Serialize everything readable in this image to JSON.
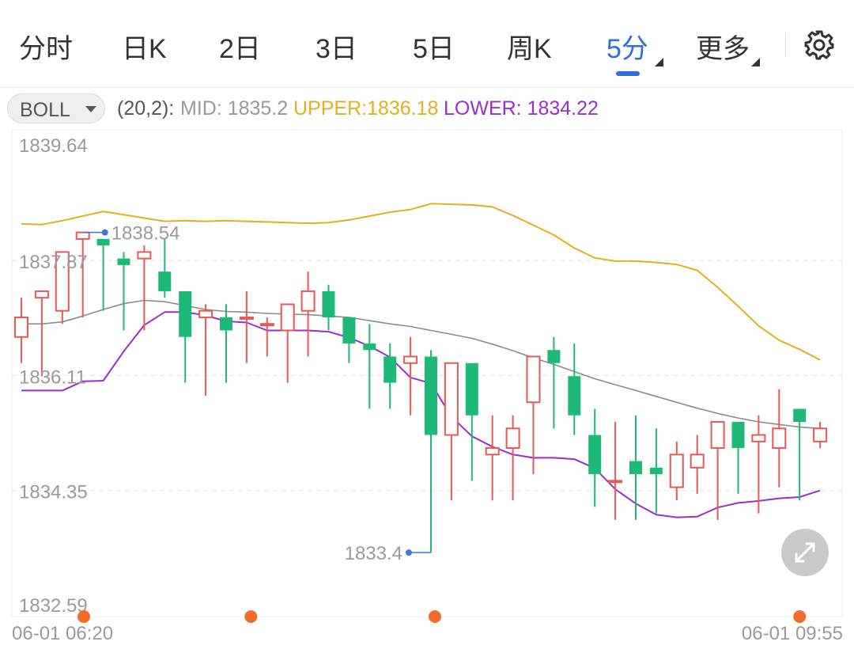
{
  "tabs": [
    {
      "label": "分时"
    },
    {
      "label": "日K"
    },
    {
      "label": "2日"
    },
    {
      "label": "3日"
    },
    {
      "label": "5日"
    },
    {
      "label": "周K"
    },
    {
      "label": "5分",
      "active": true,
      "has_menu": true
    },
    {
      "label": "更多",
      "has_menu": true
    }
  ],
  "settings_icon": "gear-icon",
  "indicator": {
    "selector_label": "BOLL",
    "params": "(20,2):",
    "mid": "MID: 1835.2",
    "upper": "UPPER:1836.18",
    "lower": "LOWER: 1834.22",
    "colors": {
      "params": "#555555",
      "mid": "#999999",
      "upper": "#e2b01e",
      "lower": "#9a2fc9"
    }
  },
  "expand_icon": "expand-arrows-icon",
  "chart_data": {
    "type": "candlestick",
    "y_ticks": [
      "1839.64",
      "1837.87",
      "1836.11",
      "1834.35",
      "1832.59"
    ],
    "ylim": [
      1832.59,
      1839.64
    ],
    "x_labels": [
      "06-01 06:20",
      "06-01 09:55"
    ],
    "max_label": "1838.54",
    "min_label": "1833.4",
    "colors": {
      "up": "#e85858",
      "down": "#1eb978",
      "mid": "#8c8c8c",
      "upper": "#e2b01e",
      "lower": "#9a2fc9",
      "marker": "#f26d2a",
      "label_line": "#3c78d8"
    },
    "candles": [
      {
        "o": 1836.7,
        "h": 1837.3,
        "l": 1836.3,
        "c": 1837.0
      },
      {
        "o": 1837.3,
        "h": 1837.4,
        "l": 1836.1,
        "c": 1837.4
      },
      {
        "o": 1837.1,
        "h": 1837.9,
        "l": 1836.9,
        "c": 1838.0
      },
      {
        "o": 1838.2,
        "h": 1838.3,
        "l": 1837.0,
        "c": 1838.3
      },
      {
        "o": 1838.2,
        "h": 1838.2,
        "l": 1837.1,
        "c": 1838.1
      },
      {
        "o": 1837.9,
        "h": 1838.0,
        "l": 1836.8,
        "c": 1837.8
      },
      {
        "o": 1837.9,
        "h": 1838.1,
        "l": 1836.8,
        "c": 1838.0
      },
      {
        "o": 1837.7,
        "h": 1838.2,
        "l": 1837.3,
        "c": 1837.4
      },
      {
        "o": 1837.4,
        "h": 1837.4,
        "l": 1836.0,
        "c": 1836.7
      },
      {
        "o": 1837.0,
        "h": 1837.2,
        "l": 1835.8,
        "c": 1837.1
      },
      {
        "o": 1837.0,
        "h": 1837.2,
        "l": 1836.0,
        "c": 1836.8
      },
      {
        "o": 1837.0,
        "h": 1837.4,
        "l": 1836.3,
        "c": 1837.0
      },
      {
        "o": 1836.9,
        "h": 1837.0,
        "l": 1836.4,
        "c": 1836.9
      },
      {
        "o": 1836.8,
        "h": 1837.2,
        "l": 1836.0,
        "c": 1837.2
      },
      {
        "o": 1837.1,
        "h": 1837.7,
        "l": 1836.4,
        "c": 1837.4
      },
      {
        "o": 1837.4,
        "h": 1837.5,
        "l": 1836.8,
        "c": 1837.0
      },
      {
        "o": 1837.0,
        "h": 1837.0,
        "l": 1836.3,
        "c": 1836.6
      },
      {
        "o": 1836.6,
        "h": 1836.9,
        "l": 1835.6,
        "c": 1836.5
      },
      {
        "o": 1836.4,
        "h": 1836.6,
        "l": 1835.6,
        "c": 1836.0
      },
      {
        "o": 1836.3,
        "h": 1836.7,
        "l": 1835.5,
        "c": 1836.4
      },
      {
        "o": 1836.4,
        "h": 1836.5,
        "l": 1833.4,
        "c": 1835.2
      },
      {
        "o": 1835.2,
        "h": 1836.3,
        "l": 1834.2,
        "c": 1836.3
      },
      {
        "o": 1836.3,
        "h": 1836.3,
        "l": 1834.5,
        "c": 1835.5
      },
      {
        "o": 1834.9,
        "h": 1835.5,
        "l": 1834.2,
        "c": 1835.0
      },
      {
        "o": 1835.0,
        "h": 1835.5,
        "l": 1834.2,
        "c": 1835.3
      },
      {
        "o": 1835.7,
        "h": 1836.4,
        "l": 1834.6,
        "c": 1836.4
      },
      {
        "o": 1836.5,
        "h": 1836.7,
        "l": 1835.3,
        "c": 1836.3
      },
      {
        "o": 1836.1,
        "h": 1836.6,
        "l": 1835.2,
        "c": 1835.5
      },
      {
        "o": 1835.2,
        "h": 1835.6,
        "l": 1834.1,
        "c": 1834.6
      },
      {
        "o": 1834.5,
        "h": 1835.4,
        "l": 1833.9,
        "c": 1834.5
      },
      {
        "o": 1834.8,
        "h": 1835.5,
        "l": 1833.9,
        "c": 1834.6
      },
      {
        "o": 1834.7,
        "h": 1835.3,
        "l": 1834.0,
        "c": 1834.6
      },
      {
        "o": 1834.4,
        "h": 1835.1,
        "l": 1834.2,
        "c": 1834.9
      },
      {
        "o": 1834.7,
        "h": 1835.2,
        "l": 1834.3,
        "c": 1834.9
      },
      {
        "o": 1835.0,
        "h": 1835.3,
        "l": 1833.9,
        "c": 1835.4
      },
      {
        "o": 1835.4,
        "h": 1835.4,
        "l": 1834.3,
        "c": 1835.0
      },
      {
        "o": 1835.1,
        "h": 1835.5,
        "l": 1834.0,
        "c": 1835.2
      },
      {
        "o": 1835.0,
        "h": 1835.9,
        "l": 1834.4,
        "c": 1835.3
      },
      {
        "o": 1835.6,
        "h": 1835.6,
        "l": 1834.2,
        "c": 1835.4
      },
      {
        "o": 1835.1,
        "h": 1835.4,
        "l": 1835.0,
        "c": 1835.3
      }
    ],
    "boll_upper": [
      1838.43,
      1838.42,
      1838.48,
      1838.55,
      1838.62,
      1838.57,
      1838.52,
      1838.47,
      1838.48,
      1838.47,
      1838.48,
      1838.47,
      1838.46,
      1838.45,
      1838.44,
      1838.45,
      1838.49,
      1838.55,
      1838.61,
      1838.65,
      1838.74,
      1838.73,
      1838.72,
      1838.69,
      1838.56,
      1838.41,
      1838.26,
      1838.06,
      1837.91,
      1837.86,
      1837.86,
      1837.84,
      1837.81,
      1837.72,
      1837.46,
      1837.17,
      1836.87,
      1836.65,
      1836.51,
      1836.35
    ],
    "boll_mid": [
      1836.9,
      1836.9,
      1836.93,
      1837.02,
      1837.12,
      1837.21,
      1837.26,
      1837.24,
      1837.18,
      1837.12,
      1837.09,
      1837.08,
      1837.06,
      1837.05,
      1837.04,
      1837.02,
      1837.0,
      1836.95,
      1836.9,
      1836.86,
      1836.8,
      1836.74,
      1836.68,
      1836.59,
      1836.49,
      1836.38,
      1836.28,
      1836.17,
      1836.06,
      1835.97,
      1835.88,
      1835.79,
      1835.7,
      1835.61,
      1835.53,
      1835.46,
      1835.4,
      1835.36,
      1835.32,
      1835.3
    ],
    "boll_lower": [
      1835.88,
      1835.88,
      1835.88,
      1836.02,
      1836.03,
      1836.48,
      1836.88,
      1837.08,
      1837.08,
      1837.03,
      1836.94,
      1836.92,
      1836.8,
      1836.8,
      1836.8,
      1836.78,
      1836.69,
      1836.56,
      1836.39,
      1836.08,
      1835.99,
      1835.48,
      1835.18,
      1835.02,
      1834.9,
      1834.85,
      1834.85,
      1834.83,
      1834.69,
      1834.37,
      1834.15,
      1833.98,
      1833.94,
      1833.95,
      1834.09,
      1834.16,
      1834.19,
      1834.23,
      1834.25,
      1834.35
    ],
    "event_markers": [
      0,
      7,
      20,
      38
    ]
  }
}
